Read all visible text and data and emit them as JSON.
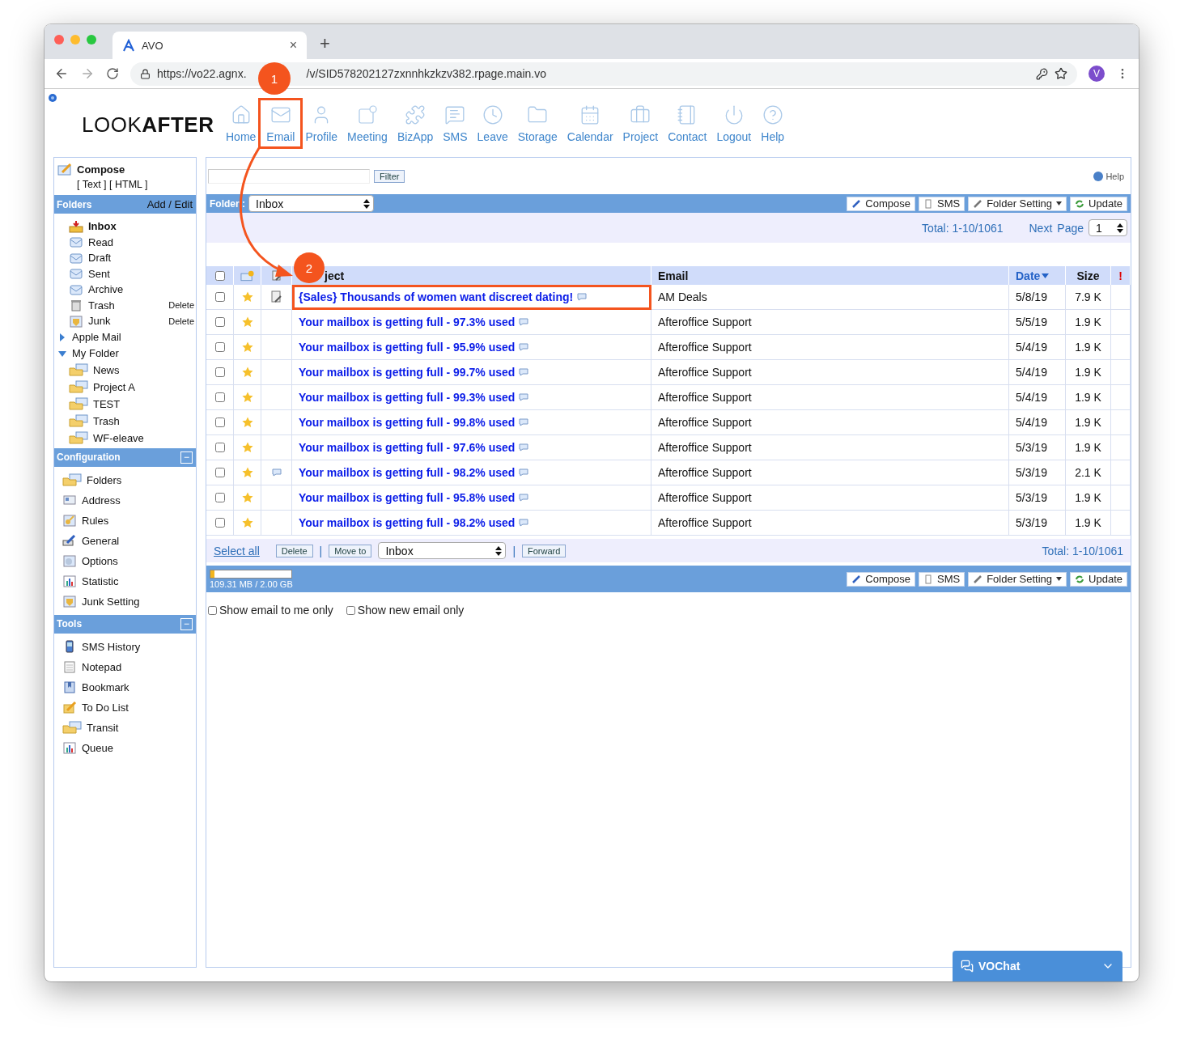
{
  "browser": {
    "tab_title": "AVO",
    "tab_close": "×",
    "new_tab": "+",
    "url_parts": [
      "https://vo22.agnx.",
      "/v/SID578202127zxnnhkzkzv382.rpage.main.vo"
    ],
    "avatar": "V"
  },
  "logo": {
    "regular": "LOOK",
    "bold": "AFTER"
  },
  "nav": [
    {
      "label": "Home"
    },
    {
      "label": "Email",
      "annotation": "1"
    },
    {
      "label": "Profile"
    },
    {
      "label": "Meeting"
    },
    {
      "label": "BizApp"
    },
    {
      "label": "SMS"
    },
    {
      "label": "Leave"
    },
    {
      "label": "Storage"
    },
    {
      "label": "Calendar"
    },
    {
      "label": "Project"
    },
    {
      "label": "Contact"
    },
    {
      "label": "Logout"
    },
    {
      "label": "Help"
    }
  ],
  "sidebar": {
    "compose": {
      "title": "Compose",
      "formats": "[ Text ] [ HTML ]"
    },
    "folders": {
      "title": "Folders",
      "action": "Add / Edit",
      "items": [
        {
          "label": "Inbox",
          "selected": true
        },
        {
          "label": "Read",
          "selected": false
        },
        {
          "label": "Draft",
          "selected": false
        },
        {
          "label": "Sent",
          "selected": false
        },
        {
          "label": "Archive",
          "selected": false
        },
        {
          "label": "Trash",
          "selected": false,
          "action": "Delete"
        },
        {
          "label": "Junk",
          "selected": false,
          "action": "Delete"
        }
      ],
      "groups": [
        {
          "label": "Apple Mail",
          "expanded": false
        },
        {
          "label": "My Folder",
          "expanded": true,
          "children": [
            {
              "label": "News"
            },
            {
              "label": "Project A"
            },
            {
              "label": "TEST"
            },
            {
              "label": "Trash"
            },
            {
              "label": "WF-eleave"
            }
          ]
        }
      ]
    },
    "configuration": {
      "title": "Configuration",
      "collapse": "−",
      "items": [
        "Folders",
        "Address",
        "Rules",
        "General",
        "Options",
        "Statistic",
        "Junk Setting"
      ]
    },
    "tools": {
      "title": "Tools",
      "collapse": "−",
      "items": [
        "SMS History",
        "Notepad",
        "Bookmark",
        "To Do List",
        "Transit",
        "Queue"
      ]
    }
  },
  "main": {
    "filter": {
      "button": "Filter"
    },
    "help": "Help",
    "toolbar": {
      "folder_label": "Folder :",
      "folder": "Inbox",
      "buttons": [
        {
          "label": "Compose"
        },
        {
          "label": "SMS"
        },
        {
          "label": "Folder Setting",
          "dropdown": true
        },
        {
          "label": "Update"
        }
      ]
    },
    "paging": {
      "total": "Total: 1-10/1061",
      "next": "Next",
      "page_label": "Page",
      "page": "1"
    },
    "table": {
      "columns": [
        "ject",
        "Email",
        "Date",
        "Size",
        "!"
      ],
      "select_all_checked": false,
      "rows": [
        {
          "checked": false,
          "starred": true,
          "kind": "document",
          "subject": "{Sales} Thousands of women want discreet dating!",
          "email": "AM Deals",
          "date": "5/8/19",
          "size": "7.9 K",
          "annotation": "2"
        },
        {
          "checked": false,
          "starred": true,
          "subject": "Your mailbox is getting full - 97.3% used",
          "email": "Afteroffice Support",
          "date": "5/5/19",
          "size": "1.9 K"
        },
        {
          "checked": false,
          "starred": true,
          "subject": "Your mailbox is getting full - 95.9% used",
          "email": "Afteroffice Support",
          "date": "5/4/19",
          "size": "1.9 K"
        },
        {
          "checked": false,
          "starred": true,
          "subject": "Your mailbox is getting full - 99.7% used",
          "email": "Afteroffice Support",
          "date": "5/4/19",
          "size": "1.9 K"
        },
        {
          "checked": false,
          "starred": true,
          "subject": "Your mailbox is getting full - 99.3% used",
          "email": "Afteroffice Support",
          "date": "5/4/19",
          "size": "1.9 K"
        },
        {
          "checked": false,
          "starred": true,
          "subject": "Your mailbox is getting full - 99.8% used",
          "email": "Afteroffice Support",
          "date": "5/4/19",
          "size": "1.9 K"
        },
        {
          "checked": false,
          "starred": true,
          "subject": "Your mailbox is getting full - 97.6% used",
          "email": "Afteroffice Support",
          "date": "5/3/19",
          "size": "1.9 K"
        },
        {
          "checked": false,
          "starred": true,
          "kind": "comment",
          "subject": "Your mailbox is getting full - 98.2% used",
          "email": "Afteroffice Support",
          "date": "5/3/19",
          "size": "2.1 K"
        },
        {
          "checked": false,
          "starred": true,
          "subject": "Your mailbox is getting full - 95.8% used",
          "email": "Afteroffice Support",
          "date": "5/3/19",
          "size": "1.9 K"
        },
        {
          "checked": false,
          "starred": true,
          "subject": "Your mailbox is getting full - 98.2% used",
          "email": "Afteroffice Support",
          "date": "5/3/19",
          "size": "1.9 K"
        }
      ]
    },
    "actions": {
      "select_all": "Select all",
      "delete": "Delete",
      "separator": "|",
      "move_to": "Move to",
      "target": "Inbox",
      "forward": "Forward",
      "total": "Total: 1-10/1061"
    },
    "bottom_buttons": [
      {
        "label": "Compose"
      },
      {
        "label": "SMS"
      },
      {
        "label": "Folder Setting",
        "dropdown": true
      },
      {
        "label": "Update"
      }
    ],
    "quota": {
      "level": 0.05,
      "reading": "109.31 MB / 2.00 GB"
    },
    "options": [
      {
        "label": "Show email to me only",
        "checked": false
      },
      {
        "label": "Show new email only",
        "checked": false
      }
    ]
  },
  "chat": {
    "label": "VOChat"
  }
}
